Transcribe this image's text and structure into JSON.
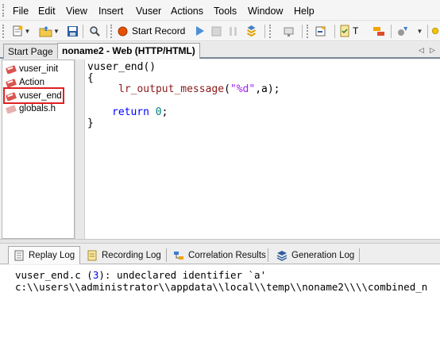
{
  "menubar": {
    "items": [
      "File",
      "Edit",
      "View",
      "Insert",
      "Vuser",
      "Actions",
      "Tools",
      "Window",
      "Help"
    ]
  },
  "toolbar": {
    "record_label": "Start Record",
    "truncated_label": "T",
    "icons": [
      "new-script-icon",
      "open-folder-icon",
      "save-icon",
      "find-icon",
      "record-icon",
      "play-icon",
      "stop-icon",
      "pause-icon",
      "compile-icon",
      "snapshot-icon",
      "add-step-icon",
      "checklist-icon",
      "arrange-icon",
      "options-icon",
      "pin-icon"
    ]
  },
  "tabs": {
    "start_page": "Start Page",
    "script_tab": "noname2 - Web (HTTP/HTML)",
    "nav_prev": "◁",
    "nav_next": "▷"
  },
  "tree": {
    "items": [
      {
        "label": "vuser_init"
      },
      {
        "label": "Action"
      },
      {
        "label": "vuser_end",
        "selected": true
      },
      {
        "label": "globals.h"
      }
    ]
  },
  "code": {
    "line1": "vuser_end()",
    "line2": "{",
    "line3_func": "lr_output_message",
    "line3_paren_open": "(",
    "line3_str": "\"%d\"",
    "line3_args": ",a);",
    "line4_kw": "return",
    "line4_num": "0",
    "line4_end": ";",
    "line5": "}"
  },
  "output_tabs": [
    {
      "label": "Replay Log",
      "active": true
    },
    {
      "label": "Recording Log"
    },
    {
      "label": "Correlation Results"
    },
    {
      "label": "Generation Log"
    }
  ],
  "output": {
    "line1_file": "vuser_end.c (",
    "line1_num": "3",
    "line1_rest": "): undeclared identifier `a'",
    "line2": "c:\\\\users\\\\administrator\\\\appdata\\\\local\\\\temp\\\\noname2\\\\\\\\combined_n"
  },
  "colors": {
    "func_red": "#8b1a1a",
    "string_purple": "#a020f0",
    "keyword_blue": "#0000ff",
    "number_teal": "#008080",
    "selection_outline": "#e02020"
  }
}
